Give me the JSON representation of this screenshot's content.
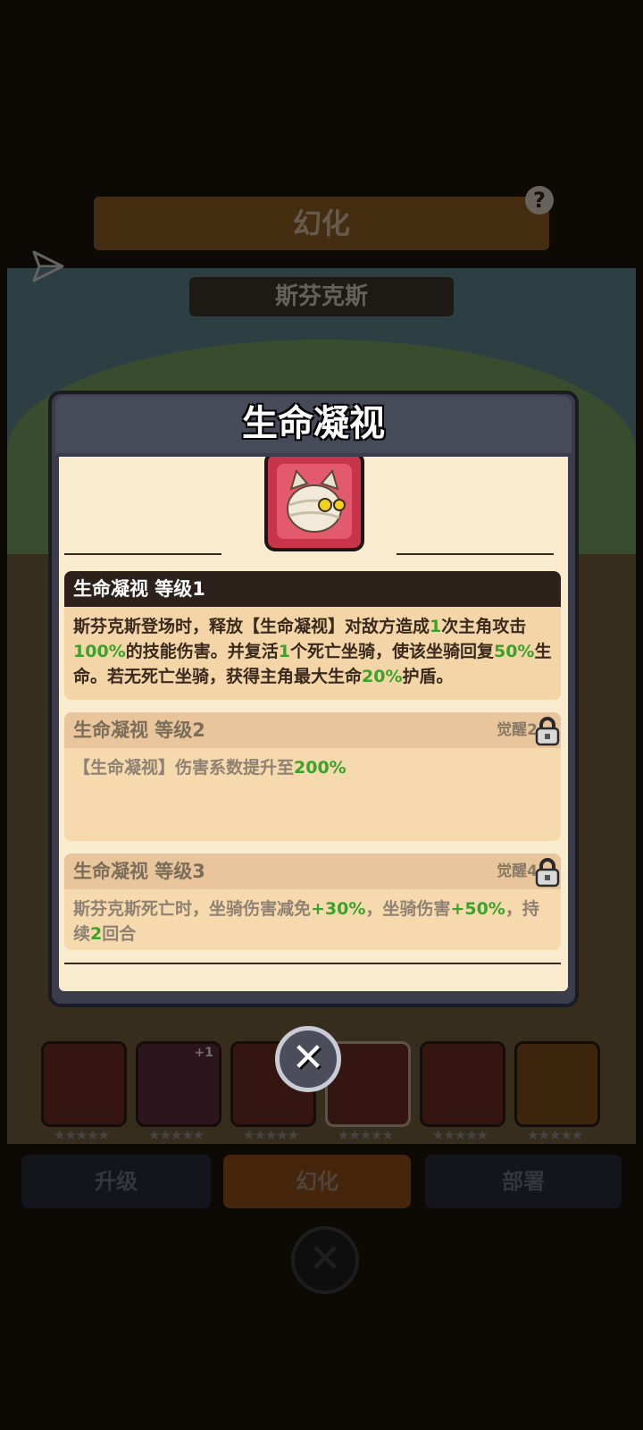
{
  "background": {
    "screen_title": "幻化",
    "hero_name": "斯芬克斯",
    "help_icon": "?",
    "tabs": [
      "升级",
      "幻化",
      "部署"
    ],
    "hero_stars": "★★★★★",
    "hero_badge": "+1"
  },
  "modal": {
    "title": "生命凝视",
    "skill_icon": "mummy-cat-icon",
    "levels": [
      {
        "title": "生命凝视 等级1",
        "text_parts": [
          "斯芬克斯登场时，释放【生命凝视】对敌方造成",
          "1",
          "次主角攻击",
          "100%",
          "的技能伤害。并复活",
          "1",
          "个死亡坐骑，使该坐骑回复",
          "50%",
          "生命。若无死亡坐骑，获得主角最大生命",
          "20%",
          "护盾。"
        ]
      },
      {
        "title": "生命凝视 等级2",
        "requirement": "觉醒2",
        "locked": true,
        "text_parts": [
          "【生命凝视】伤害系数提升至",
          "200%"
        ]
      },
      {
        "title": "生命凝视 等级3",
        "requirement": "觉醒4",
        "locked": true,
        "text_parts": [
          "斯芬克斯死亡时，坐骑伤害减免",
          "+30%",
          "，坐骑伤害",
          "+50%",
          "，持续",
          "2",
          "回合"
        ]
      }
    ],
    "close_icon": "close-icon"
  },
  "colors": {
    "accent_green": "#39a32a",
    "parchment": "#f9ecce",
    "header_dark": "#2c211b",
    "header_locked": "#e8c59a"
  }
}
